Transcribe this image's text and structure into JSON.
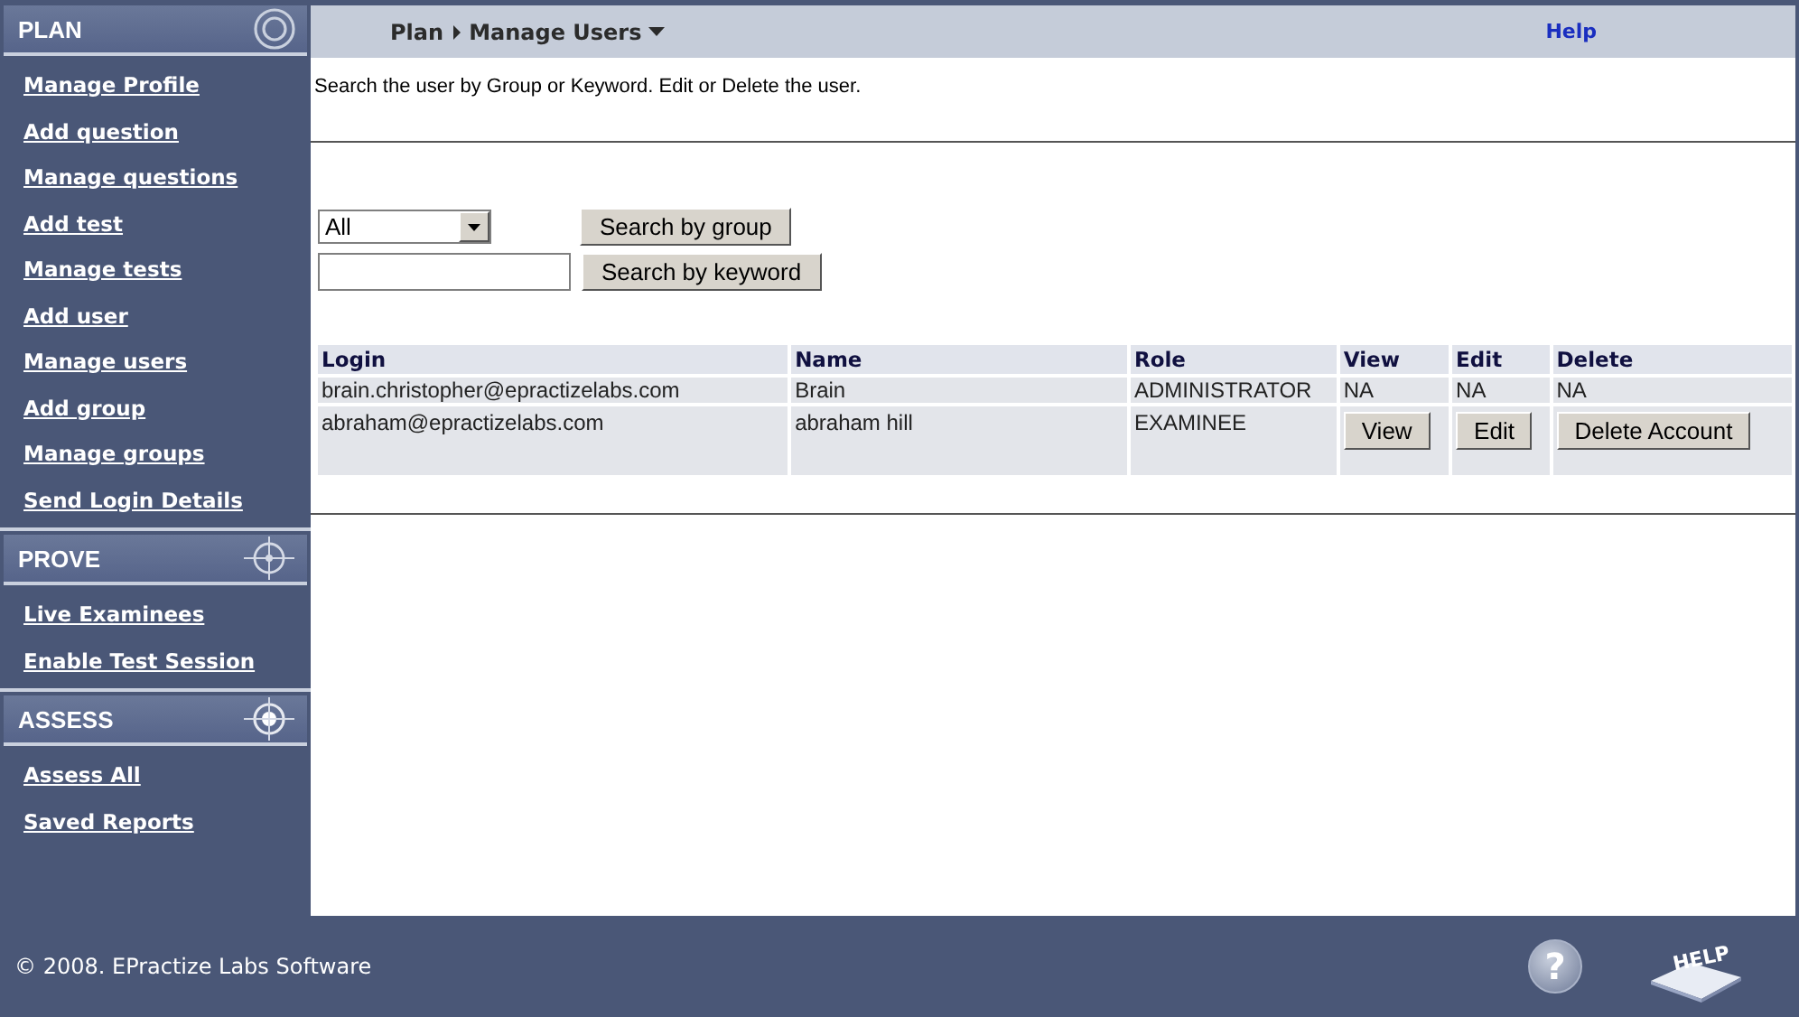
{
  "sidebar": {
    "sections": [
      {
        "title": "PLAN",
        "kind": "rings",
        "items": [
          {
            "label": "Manage Profile"
          },
          {
            "label": "Add question"
          },
          {
            "label": "Manage questions"
          },
          {
            "label": "Add test"
          },
          {
            "label": "Manage tests"
          },
          {
            "label": "Add user"
          },
          {
            "label": "Manage users"
          },
          {
            "label": "Add group"
          },
          {
            "label": "Manage groups"
          },
          {
            "label": "Send Login Details"
          }
        ]
      },
      {
        "title": "PROVE",
        "kind": "crosshair",
        "items": [
          {
            "label": "Live Examinees"
          },
          {
            "label": "Enable Test Session"
          }
        ]
      },
      {
        "title": "ASSESS",
        "kind": "crosshair-dot",
        "items": [
          {
            "label": "Assess All"
          },
          {
            "label": "Saved Reports"
          }
        ]
      }
    ]
  },
  "breadcrumb": {
    "items": [
      "Plan",
      "Manage Users"
    ],
    "help_link": "Help"
  },
  "description": "Search the user by Group or Keyword. Edit or Delete the user.",
  "search": {
    "group_select": {
      "value": "All"
    },
    "group_button": "Search by group",
    "keyword_button": "Search by keyword"
  },
  "table": {
    "columns": [
      "Login",
      "Name",
      "Role",
      "View",
      "Edit",
      "Delete"
    ],
    "rows": [
      {
        "cells": [
          {
            "kind": "text",
            "text": "brain.christopher@epractizelabs.com"
          },
          {
            "kind": "text",
            "text": "Brain"
          },
          {
            "kind": "text",
            "text": "ADMINISTRATOR"
          },
          {
            "kind": "text",
            "text": "NA"
          },
          {
            "kind": "text",
            "text": "NA"
          },
          {
            "kind": "text",
            "text": "NA"
          }
        ]
      },
      {
        "cells": [
          {
            "kind": "text",
            "text": "abraham@epractizelabs.com"
          },
          {
            "kind": "text",
            "text": "abraham hill"
          },
          {
            "kind": "text",
            "text": "EXAMINEE"
          },
          {
            "kind": "button",
            "text": "View"
          },
          {
            "kind": "button",
            "text": "Edit"
          },
          {
            "kind": "button",
            "text": "Delete Account"
          }
        ]
      }
    ]
  },
  "footer": {
    "copyright": "© 2008. EPractize Labs Software",
    "help_glyph": "?",
    "help_book_label": "HELP"
  }
}
